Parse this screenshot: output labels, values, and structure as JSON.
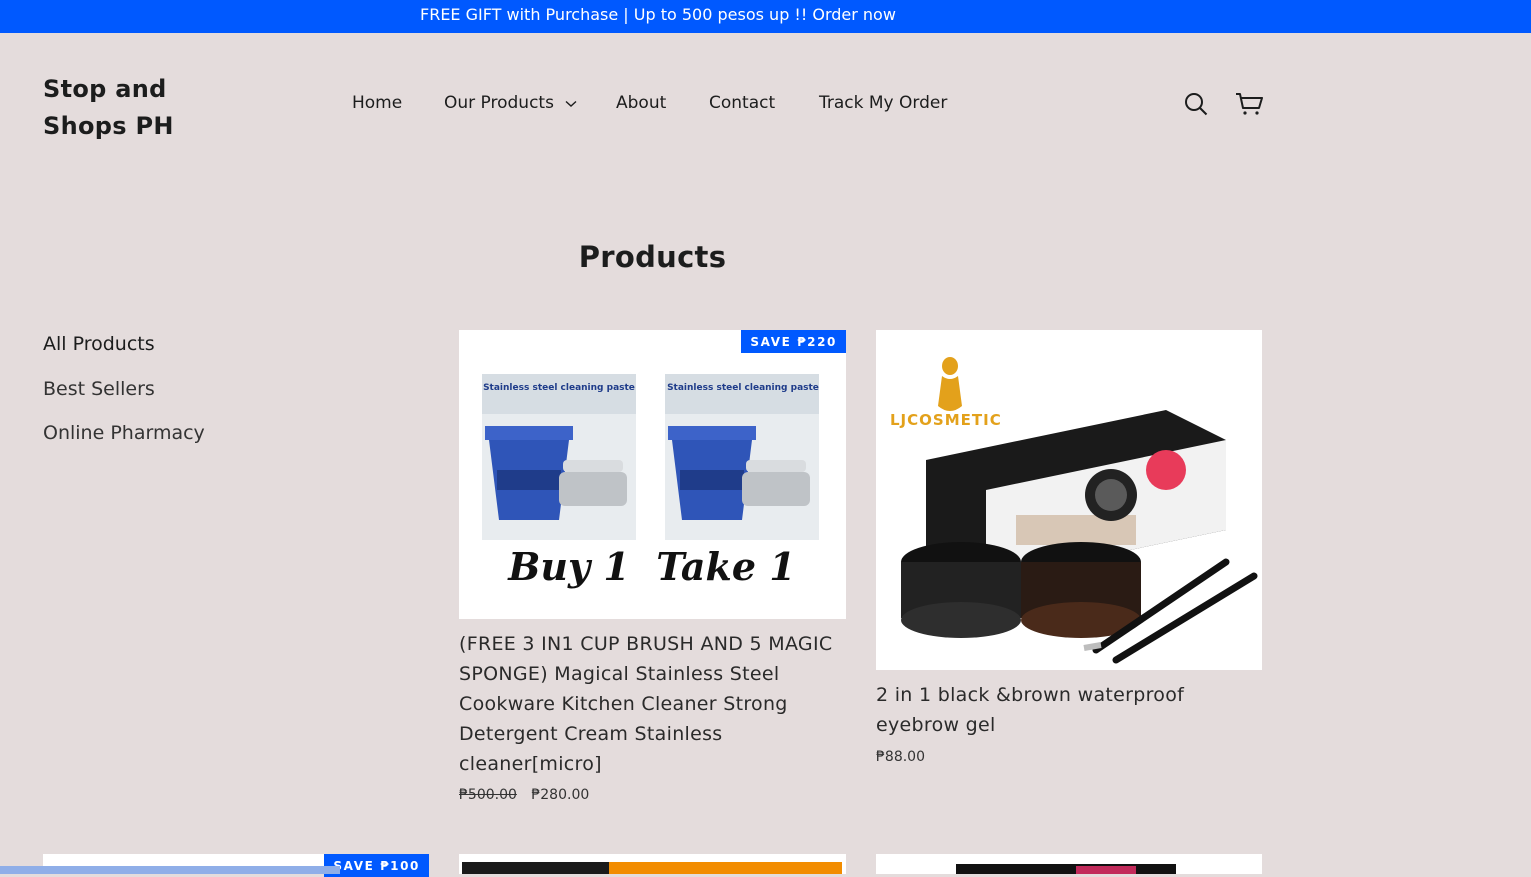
{
  "announcement": "FREE GIFT with Purchase | Up to 500 pesos up !! Order now",
  "brand": {
    "line1": "Stop and",
    "line2": "Shops PH"
  },
  "nav": {
    "home": "Home",
    "products": "Our Products",
    "about": "About",
    "contact": "Contact",
    "track": "Track My Order"
  },
  "icons": {
    "search": "search-icon",
    "cart": "cart-icon",
    "dropdown": "chevron-down-icon"
  },
  "page_title": "Products",
  "sidebar": {
    "items": [
      {
        "label": "All Products"
      },
      {
        "label": "Best Sellers"
      },
      {
        "label": "Online Pharmacy"
      }
    ]
  },
  "products": [
    {
      "badge": "SAVE ₱220",
      "title": "(FREE 3 IN1 CUP BRUSH AND 5 MAGIC SPONGE) Magical Stainless Steel Cookware Kitchen Cleaner Strong Detergent Cream Stainless cleaner[micro]",
      "price_old": "₱500.00",
      "price": "₱280.00",
      "image": {
        "caption": "Buy 1  Take 1",
        "label_left": "Stainless steel cleaning paste",
        "label_right": "Stainless steel cleaning paste"
      }
    },
    {
      "title": "2 in 1 black &brown waterproof eyebrow gel",
      "price": "₱88.00",
      "image": {
        "brand": "LJCOSMETIC"
      }
    },
    {
      "badge": "SAVE ₱100"
    }
  ],
  "colors": {
    "accent": "#0059ff",
    "background": "#e4dcdc"
  }
}
